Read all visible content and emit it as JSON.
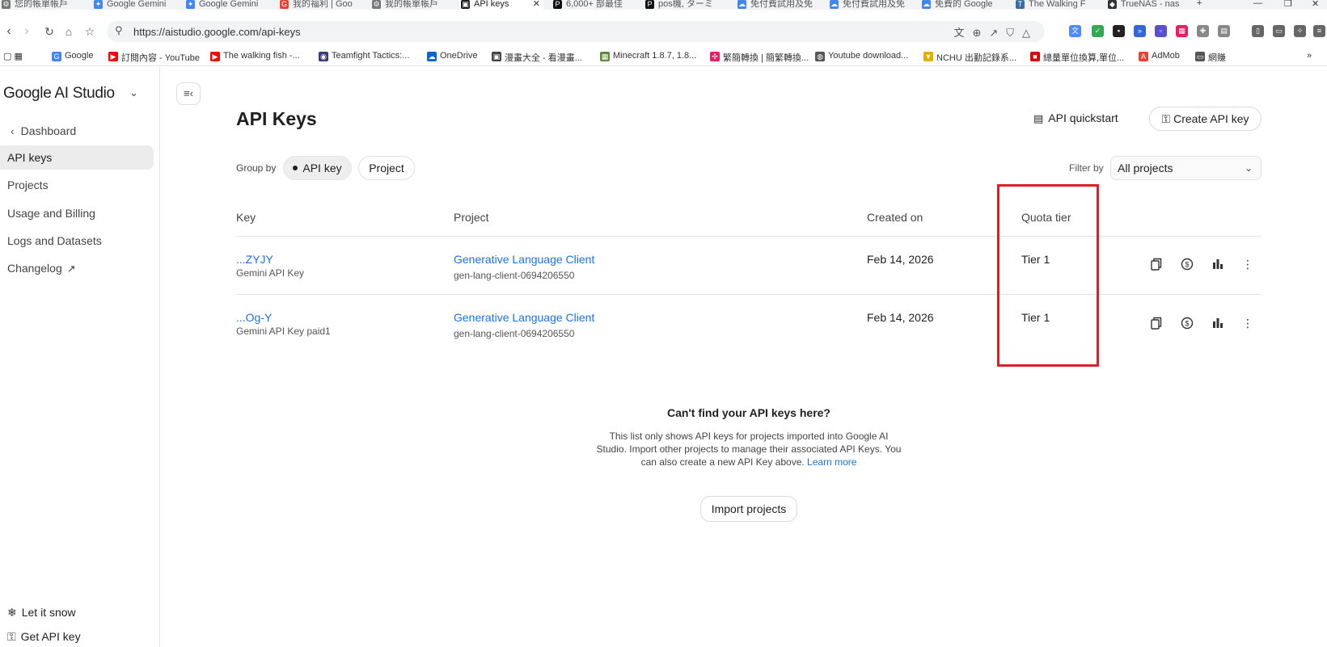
{
  "browser": {
    "tabs": [
      {
        "title": "您的帳單帳戶",
        "icon": "gear-icon",
        "color": "#777777"
      },
      {
        "title": "Google Gemini",
        "icon": "gemini-icon",
        "color": "#4285f4"
      },
      {
        "title": "Google Gemini",
        "icon": "gemini-icon",
        "color": "#4285f4"
      },
      {
        "title": "我的福利 | Goo",
        "icon": "google-icon",
        "color": "#ea4335"
      },
      {
        "title": "我的帳單帳戶",
        "icon": "gear-icon",
        "color": "#777777"
      },
      {
        "title": "API keys",
        "icon": "aistudio-icon",
        "color": "#1f1f1f",
        "active": true
      },
      {
        "title": "6,000+ 部最佳",
        "icon": "pexels-icon",
        "color": "#111111"
      },
      {
        "title": "pos機, ターミ",
        "icon": "pexels-icon",
        "color": "#111111"
      },
      {
        "title": "免付費試用及免",
        "icon": "gcloud-icon",
        "color": "#4285f4"
      },
      {
        "title": "免付費試用及免",
        "icon": "gcloud-icon",
        "color": "#4285f4"
      },
      {
        "title": "免費的 Google",
        "icon": "gcloud-icon",
        "color": "#4285f4"
      },
      {
        "title": "The Walking F",
        "icon": "tw-icon",
        "color": "#3a6ea5"
      },
      {
        "title": "TrueNAS - nas",
        "icon": "truenas-icon",
        "color": "#333333"
      }
    ],
    "url": "https://aistudio.google.com/api-keys",
    "bookmarks": [
      {
        "label": "Google",
        "icon": "google-icon",
        "color": "#4285f4"
      },
      {
        "label": "訂閱內容 - YouTube",
        "icon": "youtube-icon",
        "color": "#ff0000"
      },
      {
        "label": "The walking fish -...",
        "icon": "youtube-icon",
        "color": "#ff0000"
      },
      {
        "label": "Teamfight Tactics:...",
        "icon": "tft-icon",
        "color": "#3b3b7a"
      },
      {
        "label": "OneDrive",
        "icon": "cloud-icon",
        "color": "#0a64d6"
      },
      {
        "label": "漫畫大全 - 看漫畫...",
        "icon": "manga-icon",
        "color": "#444444"
      },
      {
        "label": "Minecraft 1.8.7, 1.8...",
        "icon": "minecraft-icon",
        "color": "#5b8a3a"
      },
      {
        "label": "繁簡轉換 | 簡繁轉換...",
        "icon": "convert-icon",
        "color": "#e91e63"
      },
      {
        "label": "Youtube download...",
        "icon": "globe-icon",
        "color": "#555555"
      },
      {
        "label": "NCHU 出勤記錄系...",
        "icon": "nchu-icon",
        "color": "#e0b000"
      },
      {
        "label": "總量單位換算,單位...",
        "icon": "red-square-icon",
        "color": "#e00000"
      },
      {
        "label": "AdMob",
        "icon": "admob-icon",
        "color": "#ea4335"
      },
      {
        "label": "網賺",
        "icon": "folder-icon",
        "color": "#555555"
      }
    ]
  },
  "sidebar": {
    "brand": "Google AI Studio",
    "back_label": "Dashboard",
    "items": [
      {
        "label": "API keys",
        "active": true
      },
      {
        "label": "Projects"
      },
      {
        "label": "Usage and Billing"
      },
      {
        "label": "Logs and Datasets"
      },
      {
        "label": "Changelog"
      }
    ],
    "footer": {
      "snow": "Let it snow",
      "get_key": "Get API key"
    }
  },
  "main": {
    "title": "API Keys",
    "quickstart_label": "API quickstart",
    "create_label": "Create API key",
    "group_by_label": "Group by",
    "group_options": [
      "API key",
      "Project"
    ],
    "filter_label": "Filter by",
    "filter_value": "All projects",
    "columns": [
      "Key",
      "Project",
      "Created on",
      "Quota tier"
    ],
    "rows": [
      {
        "key": "...ZYJY",
        "key_name": "Gemini API Key",
        "project": "Generative Language Client",
        "project_id": "gen-lang-client-0694206550",
        "created": "Feb 14, 2026",
        "tier": "Tier 1"
      },
      {
        "key": "...Og-Y",
        "key_name": "Gemini API Key paid1",
        "project": "Generative Language Client",
        "project_id": "gen-lang-client-0694206550",
        "created": "Feb 14, 2026",
        "tier": "Tier 1"
      }
    ],
    "empty": {
      "title": "Can't find your API keys here?",
      "desc": "This list only shows API keys for projects imported into Google AI Studio. Import other projects to manage their associated API Keys. You can also create a new API Key above.",
      "learn_more": "Learn more",
      "import_label": "Import projects"
    }
  },
  "colors": {
    "link": "#1a73e8",
    "highlight": "#dd1f26",
    "active_bg": "#ececec"
  }
}
